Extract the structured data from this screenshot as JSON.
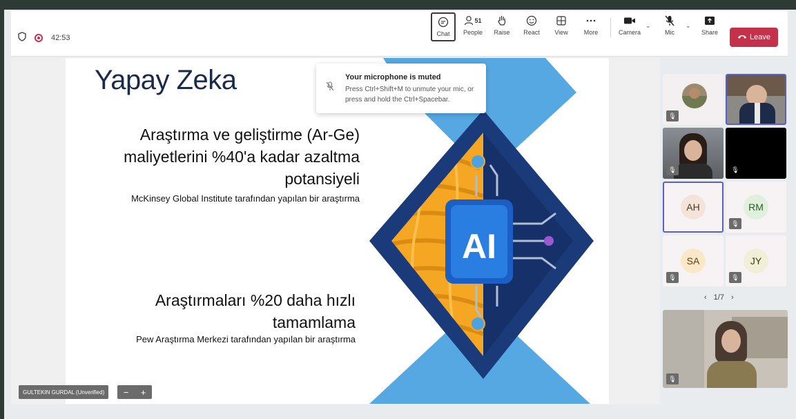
{
  "topbar": {
    "timer": "42:53",
    "buttons": [
      {
        "key": "chat",
        "label": "Chat",
        "icon": "chat-icon"
      },
      {
        "key": "people",
        "label": "People",
        "icon": "people-icon",
        "count": "51"
      },
      {
        "key": "raise",
        "label": "Raise",
        "icon": "hand-icon"
      },
      {
        "key": "react",
        "label": "React",
        "icon": "smiley-icon"
      },
      {
        "key": "view",
        "label": "View",
        "icon": "grid-icon"
      },
      {
        "key": "more",
        "label": "More",
        "icon": "ellipsis-icon"
      },
      {
        "key": "camera",
        "label": "Camera",
        "icon": "camera-icon"
      },
      {
        "key": "mic",
        "label": "Mic",
        "icon": "mic-muted-icon"
      },
      {
        "key": "share",
        "label": "Share",
        "icon": "share-icon"
      }
    ],
    "leave_label": "Leave",
    "colors": {
      "leave": "#c4314b",
      "record": "#c4314b"
    }
  },
  "slide": {
    "title": "Yapay Zeka",
    "block1": {
      "line1": "Araştırma ve geliştirme (Ar-Ge)",
      "line2": "maliyetlerini %40'a kadar azaltma",
      "line3": "potansiyeli"
    },
    "block1_source": "McKinsey Global Institute tarafından yapılan bir araştırma",
    "block2": {
      "line1": "Araştırmaları %20 daha hızlı",
      "line2": "tamamlama"
    },
    "block2_source": "Pew Araştırma Merkezi tarafından yapılan bir araştırma",
    "graphic_label": "AI",
    "colors": {
      "navy": "#1a3a7a",
      "sky": "#4da3e0",
      "chip": "#2a7de1",
      "brain": "#f5a623"
    }
  },
  "toast": {
    "title": "Your microphone is muted",
    "body": "Press Ctrl+Shift+M to unmute your mic, or press and hold the Ctrl+Spacebar."
  },
  "presenter": {
    "name": "GULTEKIN GURDAL (Unverified)",
    "zoom_out": "−",
    "zoom_in": "+"
  },
  "participants": {
    "initials": [
      {
        "initials": "AH",
        "bg": "#f3e3d8"
      },
      {
        "initials": "RM",
        "bg": "#dff0dc"
      },
      {
        "initials": "SA",
        "bg": "#fbe8c8"
      },
      {
        "initials": "JY",
        "bg": "#f1efd8"
      }
    ],
    "pager": "1/7",
    "prev": "‹",
    "next": "›"
  }
}
